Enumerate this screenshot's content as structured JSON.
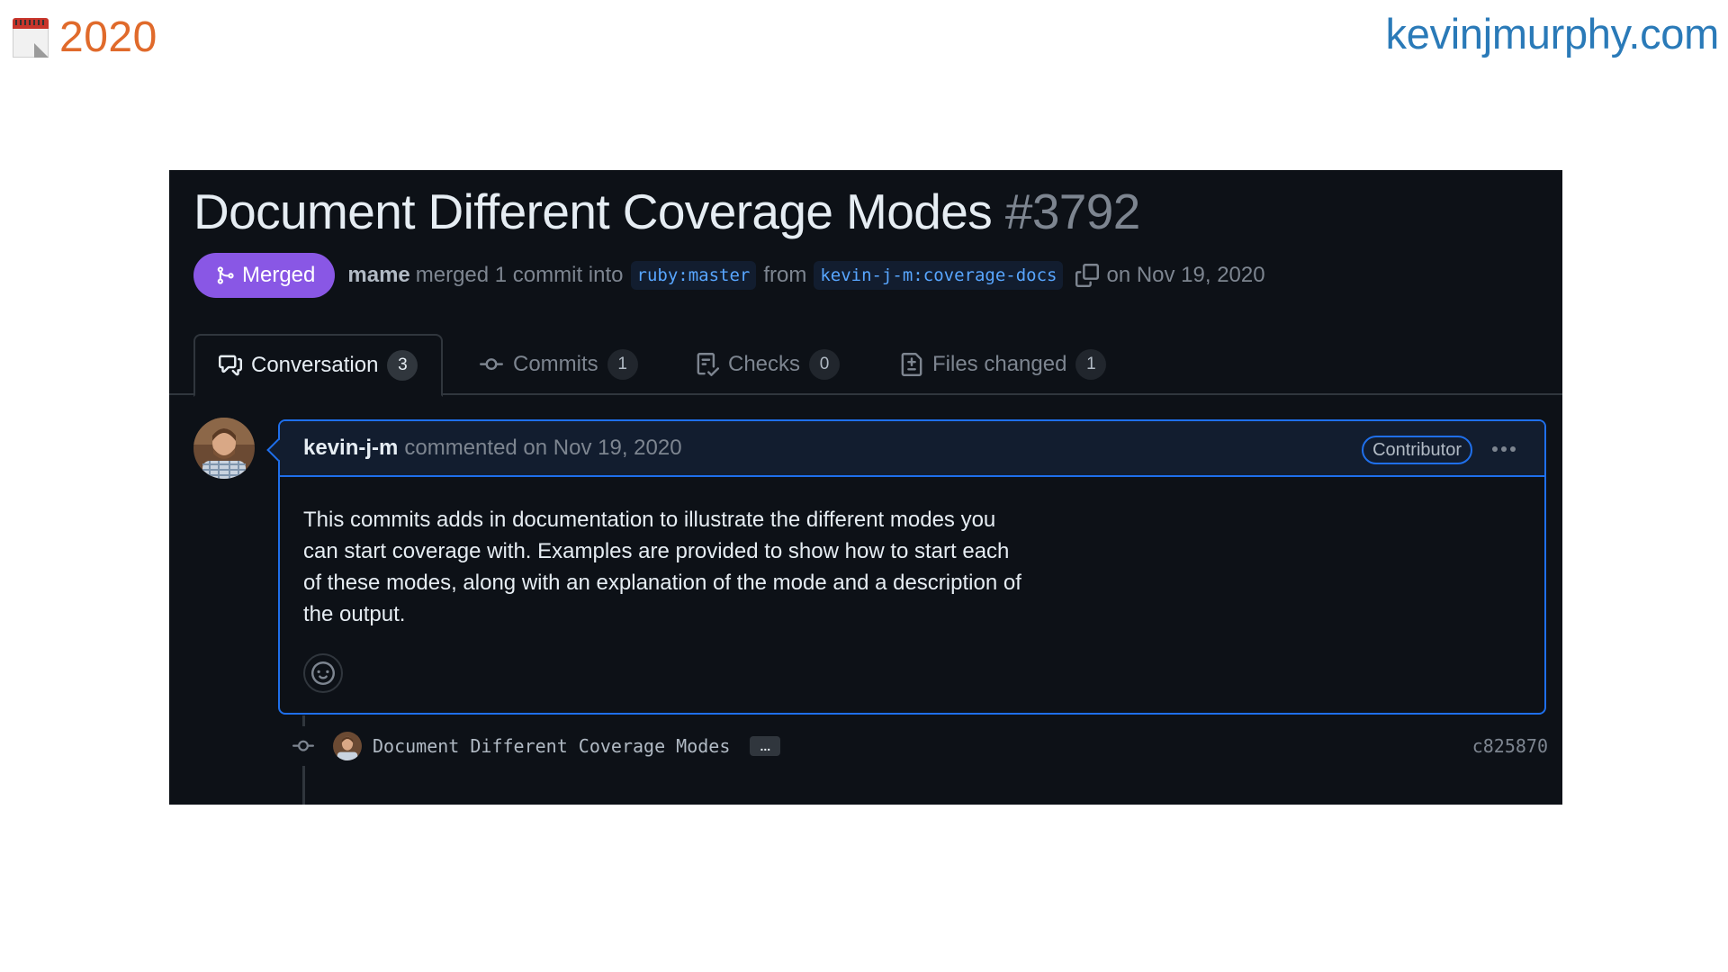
{
  "slide": {
    "year": "2020",
    "site": "kevinjmurphy.com",
    "icons": {
      "calendar": "calendar-icon"
    }
  },
  "pr": {
    "title": "Document Different Coverage Modes",
    "number": "#3792",
    "state_label": "Merged",
    "merger": "mame",
    "merged_text": "merged 1 commit into",
    "base_branch": "ruby:master",
    "from_text": "from",
    "head_branch": "kevin-j-m:coverage-docs",
    "date_text": "on Nov 19, 2020"
  },
  "tabs": [
    {
      "label": "Conversation",
      "count": "3",
      "icon": "comment-discussion-icon",
      "active": true
    },
    {
      "label": "Commits",
      "count": "1",
      "icon": "git-commit-icon",
      "active": false
    },
    {
      "label": "Checks",
      "count": "0",
      "icon": "checklist-icon",
      "active": false
    },
    {
      "label": "Files changed",
      "count": "1",
      "icon": "file-diff-icon",
      "active": false
    }
  ],
  "comment": {
    "author": "kevin-j-m",
    "action_text": "commented on Nov 19, 2020",
    "badge": "Contributor",
    "body": "This commits adds in documentation to illustrate the different modes you can start coverage with. Examples are provided to show how to start each of these modes, along with an explanation of the mode and a description of the output."
  },
  "commit": {
    "message": "Document Different Coverage Modes",
    "ellipsis": "...",
    "sha": "c825870"
  },
  "colors": {
    "panel_bg": "#0d1117",
    "merged": "#8957e5",
    "accent_blue": "#1f6feb",
    "link_blue": "#58a6ff",
    "year_orange": "#e06a2b",
    "site_blue": "#2a7ab8"
  }
}
